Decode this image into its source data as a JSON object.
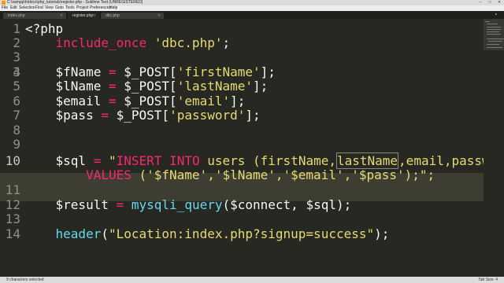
{
  "window": {
    "title": "C:\\xampp\\htdocs\\php_tutorials\\register.php - Sublime Text (UNREGISTERED)"
  },
  "menu": [
    "File",
    "Edit",
    "Selection",
    "Find",
    "View",
    "Goto",
    "Tools",
    "Project",
    "Preferences",
    "Help"
  ],
  "tabs": [
    {
      "label": "index.php",
      "active": false
    },
    {
      "label": "register.php",
      "active": true
    },
    {
      "label": "dbc.php",
      "active": false
    }
  ],
  "gutter": [
    "1",
    "2",
    "3",
    "4",
    "5",
    "6",
    "7",
    "8",
    "9",
    "10",
    "11",
    "12",
    "13",
    "14"
  ],
  "code": {
    "l1": "<?php",
    "l2_kw": "include_once",
    "l2_str": "'dbc.php'",
    "l2_end": ";",
    "l4_var": "$fName",
    "l4_op": "=",
    "l4_post": "$_POST[",
    "l4_str": "'firstName'",
    "l4_end": "];",
    "l5_var": "$lName",
    "l5_op": "=",
    "l5_post": "$_POST[",
    "l5_str": "'lastName'",
    "l5_end": "];",
    "l6_var": "$email",
    "l6_op": "=",
    "l6_post": "$_POST[",
    "l6_str": "'email'",
    "l6_end": "];",
    "l7_var": "$pass",
    "l7_op": "=",
    "l7_post": "$_POST[",
    "l7_str": "'password'",
    "l7_end": "];",
    "l10_var": "$sql",
    "l10_op": "=",
    "l10_q": "\"",
    "l10_ins": "INSERT INTO",
    "l10_rest1": " users (firstName,",
    "l10_hl": "lastName",
    "l10_rest2": ",email,password)",
    "l10b_values": "VALUES",
    "l10b_rest": " ('$fName','$lName','$email','$pass');\";",
    "l12_var": "$result",
    "l12_op": "=",
    "l12_fn": "mysqli_query",
    "l12_rest": "($connect, $sql);",
    "l14_fn": "header",
    "l14_p1": "(",
    "l14_str": "\"Location:index.php?signup=success\"",
    "l14_p2": ");"
  },
  "status": {
    "left": "9 characters selected",
    "right": "Tab Size: 4"
  },
  "colors": {
    "bg": "#272822",
    "keyword": "#f92672",
    "string": "#e6db74",
    "function": "#66d9ef",
    "text": "#f8f8f2"
  }
}
